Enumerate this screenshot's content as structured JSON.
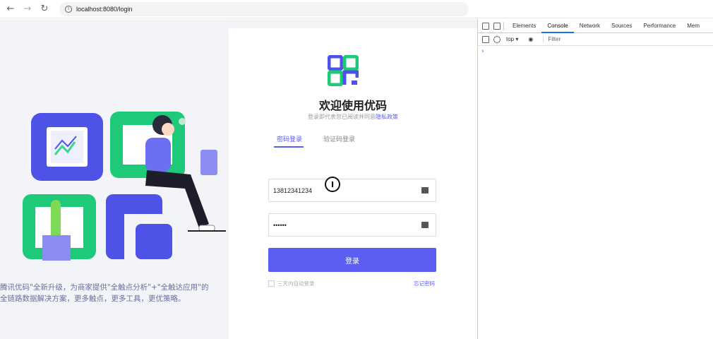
{
  "browser": {
    "back_icon": "arrow-left-icon",
    "forward_icon": "arrow-right-icon",
    "reload_icon": "reload-icon",
    "url": "localhost:8080/login"
  },
  "left": {
    "tagline_line1": "腾讯优码\"全新升级，为商家提供\"全触点分析\"+\"全触达应用\"的",
    "tagline_line2": "全链路数据解决方案，更多触点，更多工具，更优策略。"
  },
  "login": {
    "title": "欢迎使用优码",
    "subtitle_prefix": "登录即代表您已阅读并同意",
    "subtitle_link": "隐私政策",
    "tab_password": "密码登录",
    "tab_code": "验证码登录",
    "phone_value": "13812341234",
    "password_value": "••••••",
    "login_button": "登录",
    "remember_label": "三天内自动登录",
    "forgot_label": "忘记密码",
    "accent": "#5b5ef0"
  },
  "devtools": {
    "tabs": [
      "Elements",
      "Console",
      "Network",
      "Sources",
      "Performance",
      "Mem"
    ],
    "active_tab": "Console",
    "context": "top",
    "filter_placeholder": "Filter",
    "prompt": "›"
  }
}
